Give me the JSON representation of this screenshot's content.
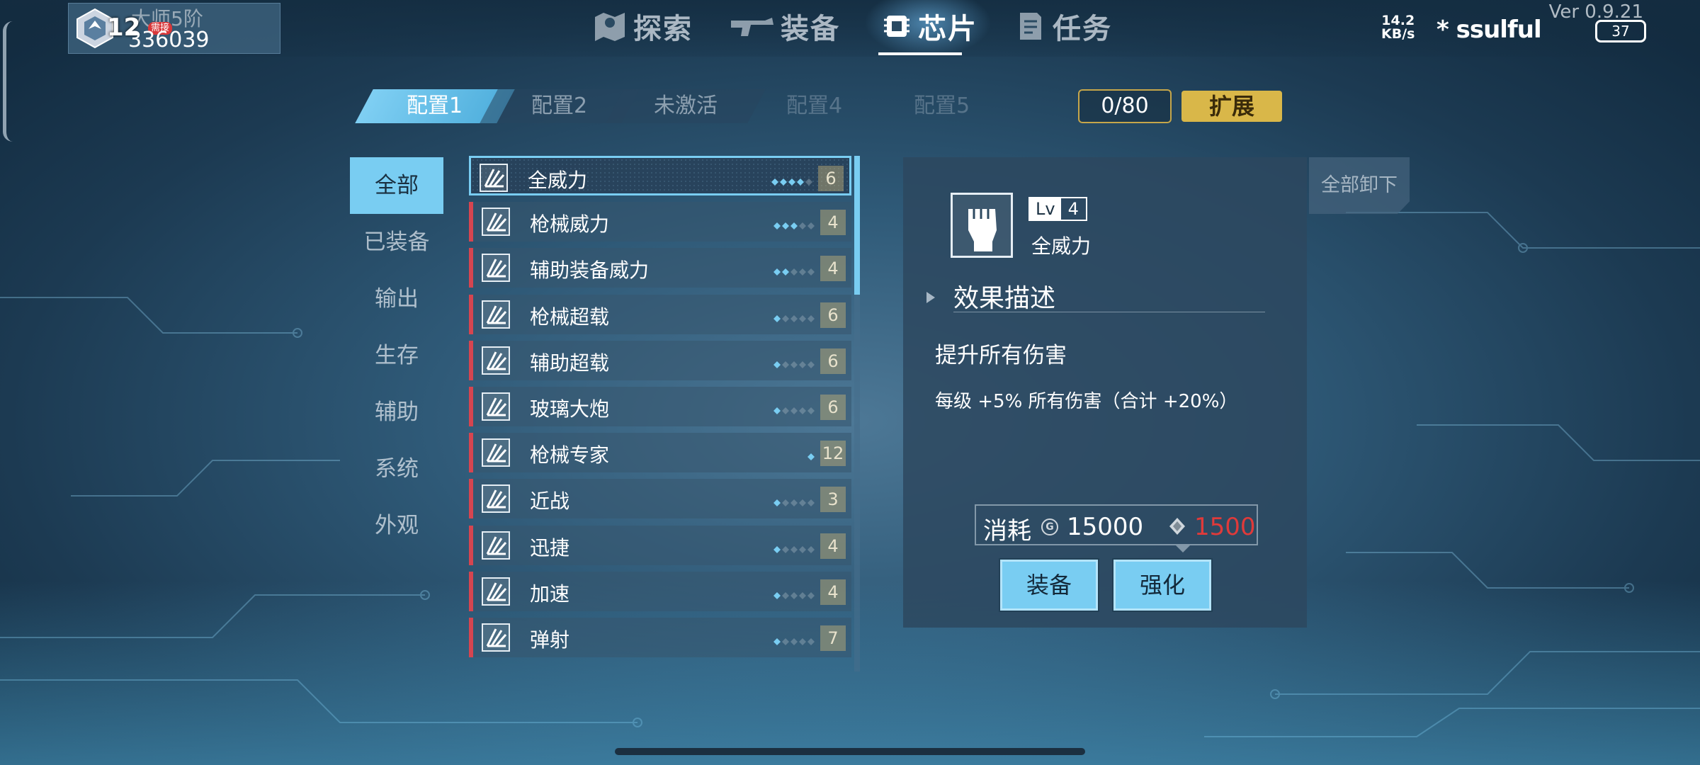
{
  "player": {
    "rank": "大师5阶",
    "level": "12",
    "badge": "需接",
    "id": "336039"
  },
  "nav": {
    "items": [
      {
        "label": "探索",
        "icon": "map-icon"
      },
      {
        "label": "装备",
        "icon": "gun-icon"
      },
      {
        "label": "芯片",
        "icon": "chip-icon"
      },
      {
        "label": "任务",
        "icon": "task-icon"
      }
    ],
    "active": "芯片"
  },
  "status": {
    "speed": "14.2",
    "speed_unit": "KB/s",
    "signal": "* ssulful",
    "version": "Ver 0.9.21",
    "battery": "37"
  },
  "configs": {
    "tabs": [
      "配置1",
      "配置2",
      "未激活",
      "配置4",
      "配置5"
    ],
    "active": "配置1"
  },
  "capacity": "0/80",
  "expand_label": "扩展",
  "categories": [
    "全部",
    "已装备",
    "输出",
    "生存",
    "辅助",
    "系统",
    "外观"
  ],
  "active_category": "全部",
  "chips": [
    {
      "name": "全威力",
      "level": "6",
      "dots": 4
    },
    {
      "name": "枪械威力",
      "level": "4",
      "dots": 3
    },
    {
      "name": "辅助装备威力",
      "level": "4",
      "dots": 2
    },
    {
      "name": "枪械超载",
      "level": "6",
      "dots": 1
    },
    {
      "name": "辅助超载",
      "level": "6",
      "dots": 1
    },
    {
      "name": "玻璃大炮",
      "level": "6",
      "dots": 1
    },
    {
      "name": "枪械专家",
      "level": "12",
      "dots": 1
    },
    {
      "name": "近战",
      "level": "3",
      "dots": 1
    },
    {
      "name": "迅捷",
      "level": "4",
      "dots": 1
    },
    {
      "name": "加速",
      "level": "4",
      "dots": 1
    },
    {
      "name": "弹射",
      "level": "7",
      "dots": 1
    }
  ],
  "selected_chip": "全威力",
  "unload_all_label": "全部卸下",
  "detail": {
    "lv_label": "Lv",
    "lv": "4",
    "name": "全威力",
    "effect_title": "效果描述",
    "effect_desc": "提升所有伤害",
    "effect_detail": "每级 +5% 所有伤害（合计 +20%）",
    "cost_label": "消耗",
    "gold_icon": "G",
    "gold_cost": "15000",
    "crystal_cost": "1500",
    "crystal_cost_color": "#e03a3a"
  },
  "buttons": {
    "equip": "装备",
    "upgrade": "强化"
  },
  "colors": {
    "accent": "#79cdf2",
    "gold": "#d9b749",
    "chip_marker": "#d64550"
  }
}
